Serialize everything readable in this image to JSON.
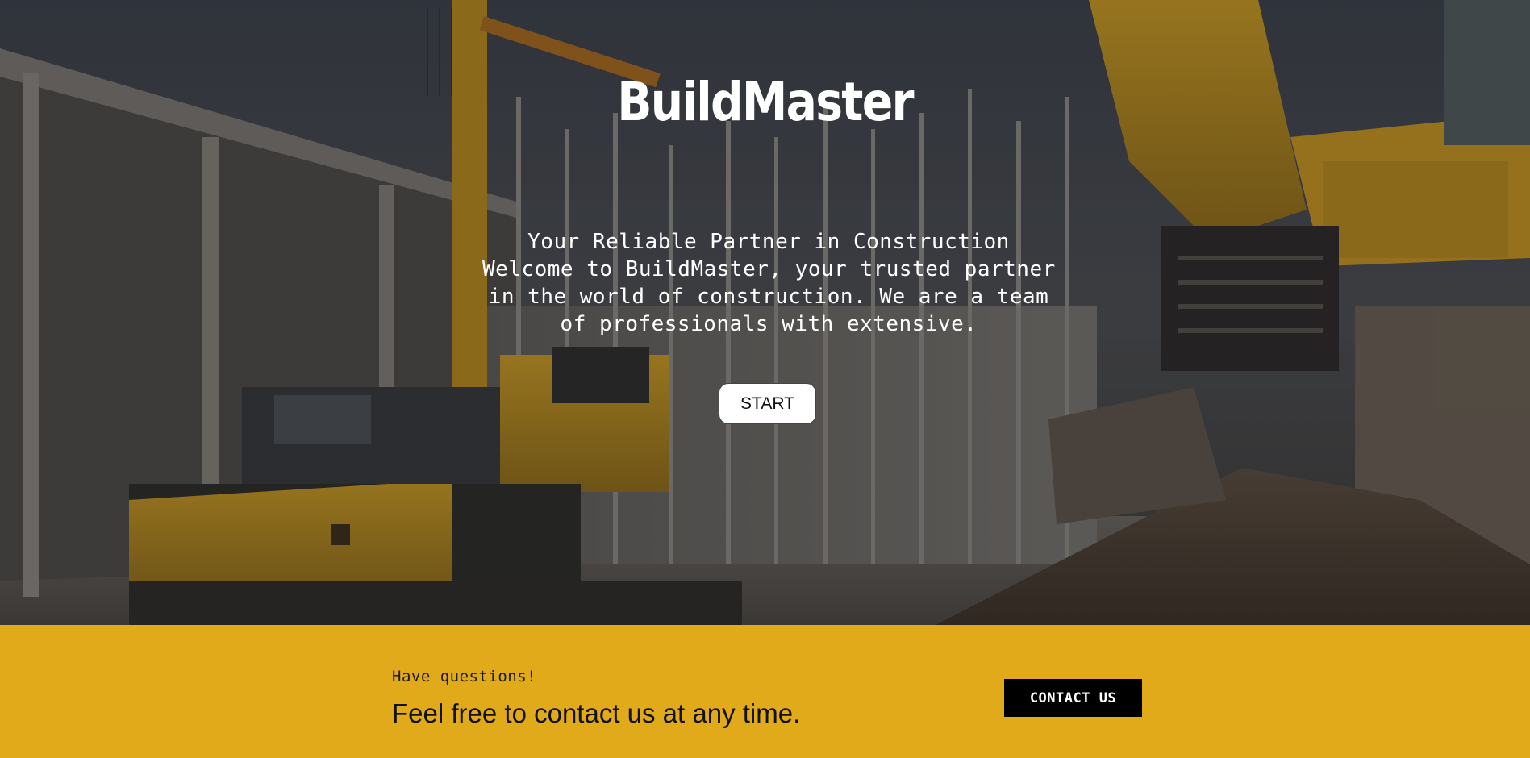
{
  "hero": {
    "brand": "BuildMaster",
    "tagline_lines": [
      "Your Reliable Partner in Construction",
      "Welcome to BuildMaster, your trusted partner",
      "in the world of construction. We are a team",
      "of professionals with extensive."
    ],
    "start_label": "START",
    "background_image": "construction-site-excavators-photo"
  },
  "cta": {
    "eyebrow": "Have questions!",
    "headline": "Feel free to contact us at any time.",
    "contact_label": "CONTACT US"
  },
  "colors": {
    "cta_background": "#e1aa1a",
    "contact_button": "#000000",
    "start_button": "#ffffff",
    "hero_text": "#ffffff"
  }
}
